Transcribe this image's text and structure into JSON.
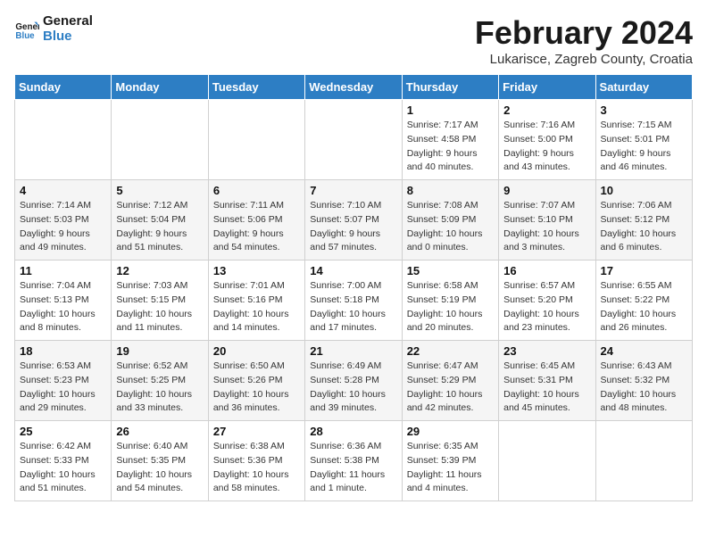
{
  "header": {
    "logo_line1": "General",
    "logo_line2": "Blue",
    "month_title": "February 2024",
    "location": "Lukarisce, Zagreb County, Croatia"
  },
  "weekdays": [
    "Sunday",
    "Monday",
    "Tuesday",
    "Wednesday",
    "Thursday",
    "Friday",
    "Saturday"
  ],
  "weeks": [
    [
      {
        "day": "",
        "info": ""
      },
      {
        "day": "",
        "info": ""
      },
      {
        "day": "",
        "info": ""
      },
      {
        "day": "",
        "info": ""
      },
      {
        "day": "1",
        "info": "Sunrise: 7:17 AM\nSunset: 4:58 PM\nDaylight: 9 hours\nand 40 minutes."
      },
      {
        "day": "2",
        "info": "Sunrise: 7:16 AM\nSunset: 5:00 PM\nDaylight: 9 hours\nand 43 minutes."
      },
      {
        "day": "3",
        "info": "Sunrise: 7:15 AM\nSunset: 5:01 PM\nDaylight: 9 hours\nand 46 minutes."
      }
    ],
    [
      {
        "day": "4",
        "info": "Sunrise: 7:14 AM\nSunset: 5:03 PM\nDaylight: 9 hours\nand 49 minutes."
      },
      {
        "day": "5",
        "info": "Sunrise: 7:12 AM\nSunset: 5:04 PM\nDaylight: 9 hours\nand 51 minutes."
      },
      {
        "day": "6",
        "info": "Sunrise: 7:11 AM\nSunset: 5:06 PM\nDaylight: 9 hours\nand 54 minutes."
      },
      {
        "day": "7",
        "info": "Sunrise: 7:10 AM\nSunset: 5:07 PM\nDaylight: 9 hours\nand 57 minutes."
      },
      {
        "day": "8",
        "info": "Sunrise: 7:08 AM\nSunset: 5:09 PM\nDaylight: 10 hours\nand 0 minutes."
      },
      {
        "day": "9",
        "info": "Sunrise: 7:07 AM\nSunset: 5:10 PM\nDaylight: 10 hours\nand 3 minutes."
      },
      {
        "day": "10",
        "info": "Sunrise: 7:06 AM\nSunset: 5:12 PM\nDaylight: 10 hours\nand 6 minutes."
      }
    ],
    [
      {
        "day": "11",
        "info": "Sunrise: 7:04 AM\nSunset: 5:13 PM\nDaylight: 10 hours\nand 8 minutes."
      },
      {
        "day": "12",
        "info": "Sunrise: 7:03 AM\nSunset: 5:15 PM\nDaylight: 10 hours\nand 11 minutes."
      },
      {
        "day": "13",
        "info": "Sunrise: 7:01 AM\nSunset: 5:16 PM\nDaylight: 10 hours\nand 14 minutes."
      },
      {
        "day": "14",
        "info": "Sunrise: 7:00 AM\nSunset: 5:18 PM\nDaylight: 10 hours\nand 17 minutes."
      },
      {
        "day": "15",
        "info": "Sunrise: 6:58 AM\nSunset: 5:19 PM\nDaylight: 10 hours\nand 20 minutes."
      },
      {
        "day": "16",
        "info": "Sunrise: 6:57 AM\nSunset: 5:20 PM\nDaylight: 10 hours\nand 23 minutes."
      },
      {
        "day": "17",
        "info": "Sunrise: 6:55 AM\nSunset: 5:22 PM\nDaylight: 10 hours\nand 26 minutes."
      }
    ],
    [
      {
        "day": "18",
        "info": "Sunrise: 6:53 AM\nSunset: 5:23 PM\nDaylight: 10 hours\nand 29 minutes."
      },
      {
        "day": "19",
        "info": "Sunrise: 6:52 AM\nSunset: 5:25 PM\nDaylight: 10 hours\nand 33 minutes."
      },
      {
        "day": "20",
        "info": "Sunrise: 6:50 AM\nSunset: 5:26 PM\nDaylight: 10 hours\nand 36 minutes."
      },
      {
        "day": "21",
        "info": "Sunrise: 6:49 AM\nSunset: 5:28 PM\nDaylight: 10 hours\nand 39 minutes."
      },
      {
        "day": "22",
        "info": "Sunrise: 6:47 AM\nSunset: 5:29 PM\nDaylight: 10 hours\nand 42 minutes."
      },
      {
        "day": "23",
        "info": "Sunrise: 6:45 AM\nSunset: 5:31 PM\nDaylight: 10 hours\nand 45 minutes."
      },
      {
        "day": "24",
        "info": "Sunrise: 6:43 AM\nSunset: 5:32 PM\nDaylight: 10 hours\nand 48 minutes."
      }
    ],
    [
      {
        "day": "25",
        "info": "Sunrise: 6:42 AM\nSunset: 5:33 PM\nDaylight: 10 hours\nand 51 minutes."
      },
      {
        "day": "26",
        "info": "Sunrise: 6:40 AM\nSunset: 5:35 PM\nDaylight: 10 hours\nand 54 minutes."
      },
      {
        "day": "27",
        "info": "Sunrise: 6:38 AM\nSunset: 5:36 PM\nDaylight: 10 hours\nand 58 minutes."
      },
      {
        "day": "28",
        "info": "Sunrise: 6:36 AM\nSunset: 5:38 PM\nDaylight: 11 hours\nand 1 minute."
      },
      {
        "day": "29",
        "info": "Sunrise: 6:35 AM\nSunset: 5:39 PM\nDaylight: 11 hours\nand 4 minutes."
      },
      {
        "day": "",
        "info": ""
      },
      {
        "day": "",
        "info": ""
      }
    ]
  ]
}
